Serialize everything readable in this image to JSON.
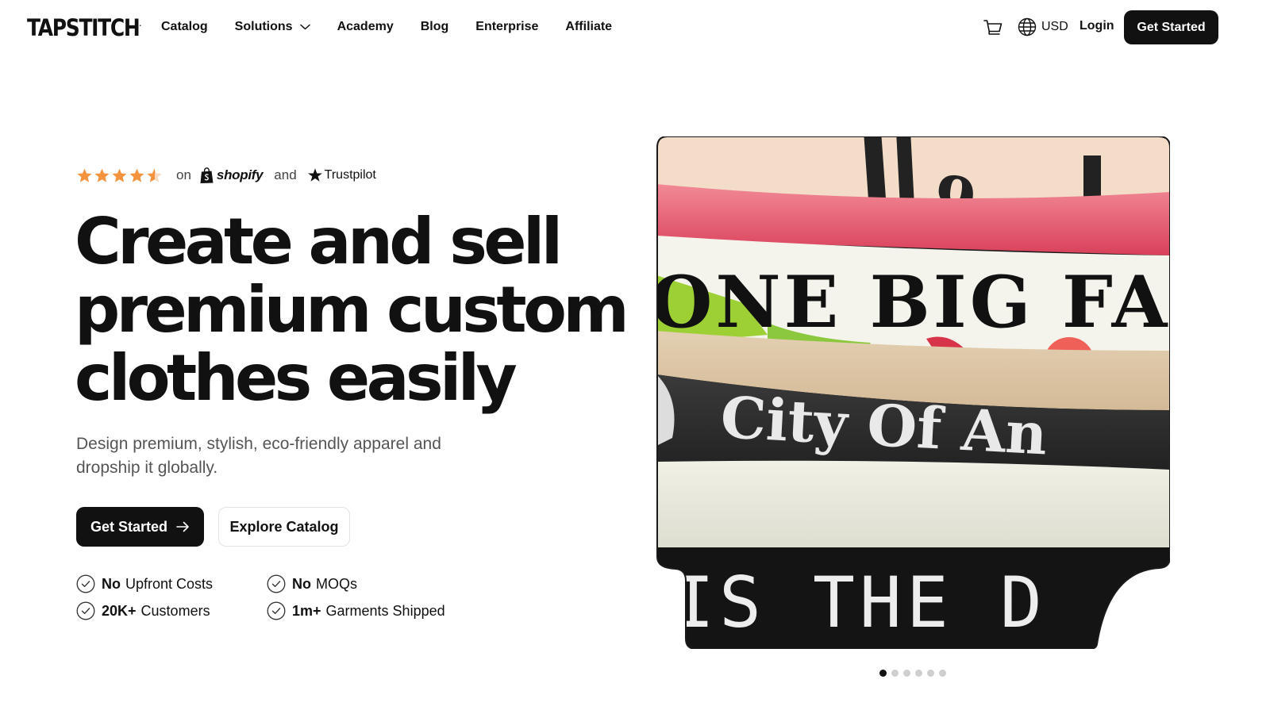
{
  "brand": {
    "name": "TAPSTITCH",
    "mark": "."
  },
  "nav": {
    "links": [
      "Catalog",
      "Solutions",
      "Academy",
      "Blog",
      "Enterprise",
      "Affiliate"
    ],
    "currency": "USD",
    "login": "Login",
    "cta": "Get Started"
  },
  "rating": {
    "stars": 4.5,
    "on_text": "on",
    "platform_1": "shopify",
    "and_text": "and",
    "platform_2": "Trustpilot"
  },
  "hero": {
    "headline_line1": "Create and sell",
    "headline_line2": "premium custom",
    "headline_line3": "clothes easily",
    "subhead": "Design premium, stylish, eco-friendly apparel and dropship it globally.",
    "cta_primary": "Get Started",
    "cta_secondary": "Explore Catalog"
  },
  "features": [
    {
      "bold": "No",
      "text": "Upfront Costs"
    },
    {
      "bold": "No",
      "text": "MOQs"
    },
    {
      "bold": "20K+",
      "text": "Customers"
    },
    {
      "bold": "1m+",
      "text": "Garments Shipped"
    }
  ],
  "image": {
    "shirt_texts": [
      "9",
      "ONE BIG FA",
      "City Of An",
      "IS THE D"
    ]
  },
  "carousel": {
    "count": 6,
    "active": 1
  },
  "colors": {
    "primary": "#111111",
    "star": "#F5923E",
    "muted_text": "#555555",
    "dot_inactive": "#CFCFCF"
  }
}
